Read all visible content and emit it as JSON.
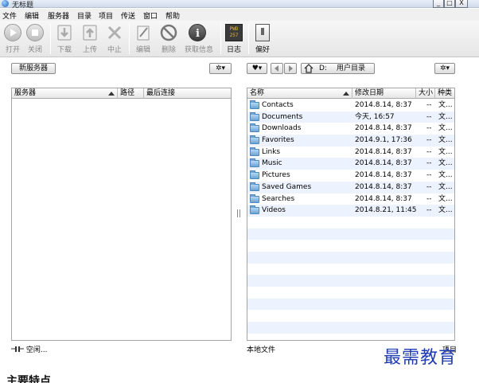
{
  "window": {
    "title": "无标题",
    "min": "_",
    "max": "□",
    "close": "X"
  },
  "menu": [
    "文件",
    "编辑",
    "服务器",
    "目录",
    "项目",
    "传送",
    "窗口",
    "帮助"
  ],
  "toolbar": {
    "open": "打开",
    "close": "关闭",
    "download": "下载",
    "upload": "上传",
    "stop": "中止",
    "edit": "编辑",
    "delete": "删除",
    "info": "获取信息",
    "log": "日志",
    "prefs": "偏好",
    "pwd_line1": "PWD",
    "pwd_line2": "257"
  },
  "left": {
    "new_server": "新服务器",
    "gear": "✲▾",
    "columns": [
      "服务器",
      "路径",
      "最后连接"
    ],
    "status": "空闲..."
  },
  "right": {
    "bookmark": "♥▾",
    "drive": "D:",
    "path_folder": "用户目录",
    "gear": "✲▾",
    "columns": [
      "名称",
      "修改日期",
      "大小",
      "种类"
    ],
    "files": [
      {
        "name": "Contacts",
        "date": "2014.8.14, 8:37",
        "size": "--",
        "kind": "文..."
      },
      {
        "name": "Documents",
        "date": "今天, 16:57",
        "size": "--",
        "kind": "文..."
      },
      {
        "name": "Downloads",
        "date": "2014.8.14, 8:37",
        "size": "--",
        "kind": "文..."
      },
      {
        "name": "Favorites",
        "date": "2014.9.1, 17:36",
        "size": "--",
        "kind": "文..."
      },
      {
        "name": "Links",
        "date": "2014.8.14, 8:37",
        "size": "--",
        "kind": "文..."
      },
      {
        "name": "Music",
        "date": "2014.8.14, 8:37",
        "size": "--",
        "kind": "文..."
      },
      {
        "name": "Pictures",
        "date": "2014.8.14, 8:37",
        "size": "--",
        "kind": "文..."
      },
      {
        "name": "Saved Games",
        "date": "2014.8.14, 8:37",
        "size": "--",
        "kind": "文..."
      },
      {
        "name": "Searches",
        "date": "2014.8.14, 8:37",
        "size": "--",
        "kind": "文..."
      },
      {
        "name": "Videos",
        "date": "2014.8.21, 11:45",
        "size": "--",
        "kind": "文..."
      }
    ],
    "status": "本地文件",
    "status_right": "项目"
  },
  "caption": "主要特点",
  "watermark": "最需教育",
  "colors": {
    "row_alt": "#edf3fe",
    "folder": "#6ea4d4",
    "watermark": "#1f3bb3"
  }
}
